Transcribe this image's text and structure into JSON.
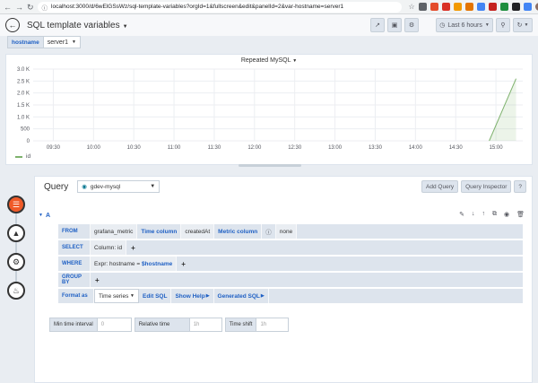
{
  "browser": {
    "url": "localhost:3000/d/6wElGSsWz/sql-template-variables?orgId=1&fullscreen&edit&panelId=2&var-hostname=server1"
  },
  "dashboard": {
    "title": "SQL template variables",
    "time_range": "Last 6 hours"
  },
  "variables": {
    "label": "hostname",
    "value": "server1"
  },
  "panel": {
    "title": "Repeated MySQL",
    "legend": "id"
  },
  "chart_data": {
    "type": "line",
    "title": "Repeated MySQL",
    "x": [
      "09:30",
      "10:00",
      "10:30",
      "11:00",
      "11:30",
      "12:00",
      "12:30",
      "13:00",
      "13:30",
      "14:00",
      "14:30",
      "15:00"
    ],
    "yticks": [
      "0",
      "500",
      "1.0 K",
      "1.5 K",
      "2.0 K",
      "2.5 K",
      "3.0 K"
    ],
    "ylim": [
      0,
      3000
    ],
    "series": [
      {
        "name": "id",
        "points": [
          [
            "14:55",
            0
          ],
          [
            "15:15",
            2600
          ]
        ]
      }
    ],
    "grid": true,
    "legend_position": "bottom-left",
    "color": "#7eb26d"
  },
  "query": {
    "title": "Query",
    "datasource": "gdev-mysql",
    "add_query": "Add Query",
    "inspector": "Query Inspector",
    "help": "?",
    "ref": "A",
    "from_kw": "FROM",
    "from_table": "grafana_metric",
    "time_col_label": "Time column",
    "time_col_value": "createdAt",
    "metric_col_label": "Metric column",
    "metric_col_value": "none",
    "select_kw": "SELECT",
    "select_value": "Column: id",
    "where_kw": "WHERE",
    "where_expr_prefix": "Expr: hostname = ",
    "where_expr_var": "$hostname",
    "groupby_kw": "GROUP BY",
    "format_kw": "Format as",
    "format_value": "Time series",
    "edit_sql": "Edit SQL",
    "show_help": "Show Help",
    "generated_sql": "Generated SQL",
    "plus": "+"
  },
  "options": {
    "min_interval_label": "Min time interval",
    "min_interval_placeholder": "0",
    "relative_time_label": "Relative time",
    "relative_time_placeholder": "1h",
    "time_shift_label": "Time shift",
    "time_shift_placeholder": "1h"
  }
}
